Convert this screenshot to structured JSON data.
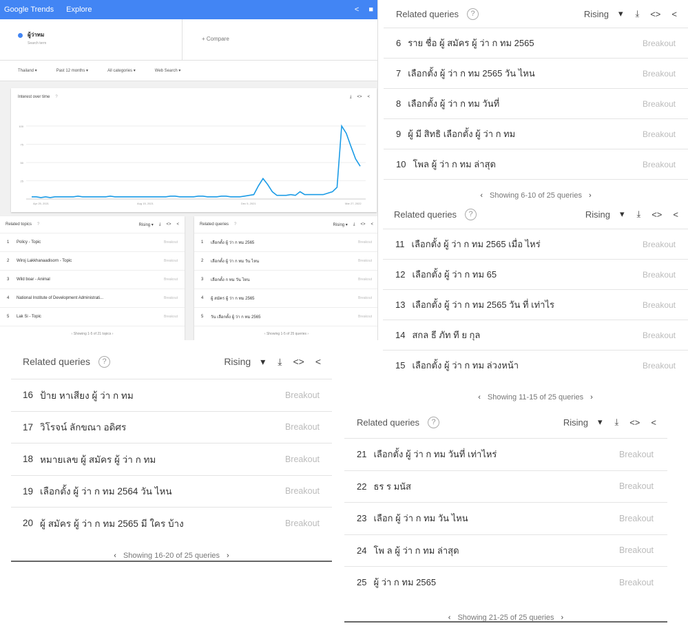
{
  "main": {
    "logo": "Google Trends",
    "nav": "Explore",
    "share_icon": "<",
    "feedback_icon": "■",
    "term": {
      "name": "ผู้ว่าทม",
      "sub": "Search term"
    },
    "compare": "+   Compare",
    "filters": [
      "Thailand ▾",
      "Past 12 months ▾",
      "All categories ▾",
      "Web Search ▾"
    ],
    "iot_title": "Interest over time",
    "help": "?",
    "x_ticks": [
      "Apr 25, 2021",
      "Aug 15, 2021",
      "Dec 5, 2021",
      "Mar 27, 2022"
    ],
    "y_ticks": [
      "100",
      "75",
      "50",
      "25"
    ],
    "topics_header": {
      "title": "Related topics",
      "mode": "Rising ▾"
    },
    "topics": [
      {
        "n": "1",
        "t": "Policy - Topic",
        "b": "Breakout"
      },
      {
        "n": "2",
        "t": "Wiroj Lakkhanaadisorn - Topic",
        "b": "Breakout"
      },
      {
        "n": "3",
        "t": "Wild boar - Animal",
        "b": "Breakout"
      },
      {
        "n": "4",
        "t": "National Institute of Development Administrati...",
        "b": "Breakout"
      },
      {
        "n": "5",
        "t": "Lak Si - Topic",
        "b": "Breakout"
      }
    ],
    "topics_footer": "‹  Showing 1-5 of 21 topics  ›",
    "queries_header": {
      "title": "Related queries",
      "mode": "Rising ▾"
    },
    "queries": [
      {
        "n": "1",
        "t": "เลือกตั้ง ผู้ ว่า ก ทม 2565",
        "b": "Breakout"
      },
      {
        "n": "2",
        "t": "เลือกตั้ง ผู้ ว่า ก ทม วัน ไหน",
        "b": "Breakout"
      },
      {
        "n": "3",
        "t": "เลือกตั้ง ก ทม วัน ไหน",
        "b": "Breakout"
      },
      {
        "n": "4",
        "t": "ผู้ สมัคร ผู้ ว่า ก ทม 2565",
        "b": "Breakout"
      },
      {
        "n": "5",
        "t": "วัน เลือกตั้ง ผู้ ว่า ก ทม 2565",
        "b": "Breakout"
      }
    ],
    "queries_footer": "‹  Showing 1-5 of 25 queries  ›"
  },
  "panel_header": {
    "title": "Related queries",
    "help": "?",
    "mode": "Rising",
    "caret": "▾",
    "download": "⤓",
    "embed": "<>",
    "share": "<"
  },
  "p610": {
    "rows": [
      {
        "n": "6",
        "t": "ราย ชื่อ ผู้ สมัคร ผู้ ว่า ก ทม 2565",
        "b": "Breakout"
      },
      {
        "n": "7",
        "t": "เลือกตั้ง ผู้ ว่า ก ทม 2565 วัน ไหน",
        "b": "Breakout"
      },
      {
        "n": "8",
        "t": "เลือกตั้ง ผู้ ว่า ก ทม วันที่",
        "b": "Breakout"
      },
      {
        "n": "9",
        "t": "ผู้ มี สิทธิ เลือกตั้ง ผู้ ว่า ก ทม",
        "b": "Breakout"
      },
      {
        "n": "10",
        "t": "โพล ผู้ ว่า ก ทม ล่าสุด",
        "b": "Breakout"
      }
    ],
    "footer": "Showing 6-10 of 25 queries"
  },
  "p1115": {
    "rows": [
      {
        "n": "11",
        "t": "เลือกตั้ง ผู้ ว่า ก ทม 2565 เมื่อ ไหร่",
        "b": "Breakout"
      },
      {
        "n": "12",
        "t": "เลือกตั้ง ผู้ ว่า ก ทม 65",
        "b": "Breakout"
      },
      {
        "n": "13",
        "t": "เลือกตั้ง ผู้ ว่า ก ทม 2565 วัน ที่ เท่าไร",
        "b": "Breakout"
      },
      {
        "n": "14",
        "t": "สกล ธี ภัท ที ย กุล",
        "b": "Breakout"
      },
      {
        "n": "15",
        "t": "เลือกตั้ง ผู้ ว่า ก ทม ล่วงหน้า",
        "b": "Breakout"
      }
    ],
    "footer": "Showing 11-15 of 25 queries"
  },
  "p1620": {
    "rows": [
      {
        "n": "16",
        "t": "ป้าย หาเสียง ผู้ ว่า ก ทม",
        "b": "Breakout"
      },
      {
        "n": "17",
        "t": "วิโรจน์ ลักขณา อดิศร",
        "b": "Breakout"
      },
      {
        "n": "18",
        "t": "หมายเลข ผู้ สมัคร ผู้ ว่า ก ทม",
        "b": "Breakout"
      },
      {
        "n": "19",
        "t": "เลือกตั้ง ผู้ ว่า ก ทม 2564 วัน ไหน",
        "b": "Breakout"
      },
      {
        "n": "20",
        "t": "ผู้ สมัคร ผู้ ว่า ก ทม 2565 มี ใคร บ้าง",
        "b": "Breakout"
      }
    ],
    "footer": "Showing 16-20 of 25 queries"
  },
  "p2125": {
    "rows": [
      {
        "n": "21",
        "t": "เลือกตั้ง ผู้ ว่า ก ทม วันที่ เท่าไหร่",
        "b": "Breakout"
      },
      {
        "n": "22",
        "t": "ธร ร มนัส",
        "b": "Breakout"
      },
      {
        "n": "23",
        "t": "เลือก ผู้ ว่า ก ทม วัน ไหน",
        "b": "Breakout"
      },
      {
        "n": "24",
        "t": "โพ ล ผู้ ว่า ก ทม ล่าสุด",
        "b": "Breakout"
      },
      {
        "n": "25",
        "t": "ผู้ ว่า ก ทม 2565",
        "b": "Breakout"
      }
    ],
    "footer": "Showing 21-25 of 25 queries"
  },
  "chart_data": {
    "type": "line",
    "x": [
      "Apr 25, 2021",
      "Aug 15, 2021",
      "Dec 5, 2021",
      "Mar 27, 2022"
    ],
    "ylim": [
      0,
      100
    ],
    "color": "#1a9be6",
    "values": [
      3,
      3,
      2,
      3,
      2,
      3,
      3,
      3,
      3,
      3,
      4,
      3,
      3,
      3,
      3,
      3,
      3,
      4,
      3,
      3,
      3,
      3,
      3,
      3,
      3,
      3,
      3,
      3,
      3,
      3,
      4,
      4,
      3,
      3,
      3,
      3,
      4,
      4,
      3,
      3,
      3,
      4,
      4,
      3,
      3,
      3,
      4,
      5,
      6,
      18,
      28,
      20,
      10,
      5,
      5,
      5,
      6,
      5,
      10,
      6,
      6,
      6,
      6,
      6,
      8,
      10,
      16,
      100,
      90,
      72,
      55,
      45
    ]
  }
}
